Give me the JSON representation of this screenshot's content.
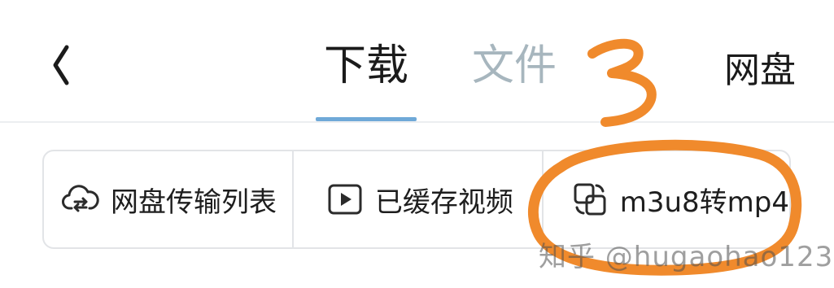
{
  "header": {
    "tabs": [
      {
        "label": "下载",
        "active": true
      },
      {
        "label": "文件",
        "active": false
      },
      {
        "label": "网盘",
        "active": false
      }
    ]
  },
  "actions": [
    {
      "label": "网盘传输列表",
      "icon": "cloud-transfer-icon"
    },
    {
      "label": "已缓存视频",
      "icon": "play-video-icon"
    },
    {
      "label": "m3u8转mp4",
      "icon": "convert-icon"
    }
  ],
  "annotation": {
    "number": "3",
    "color": "#f08a2c"
  },
  "watermark": {
    "text": "知乎 @hugaohao123"
  },
  "colors": {
    "active_tab": "#1b1b1b",
    "inactive_tab": "#a7b6be",
    "indicator": "#6fa9d8",
    "annotation": "#f08a2c"
  }
}
